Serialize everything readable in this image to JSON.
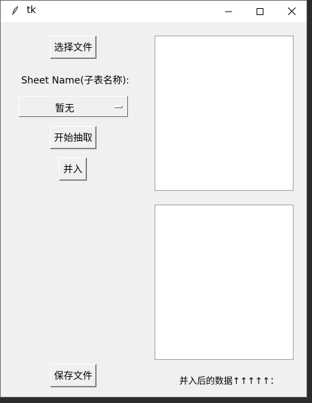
{
  "window": {
    "title": "tk",
    "icon": "feather-icon",
    "controls": {
      "minimize": "minimize-icon",
      "maximize": "maximize-icon",
      "close": "close-icon"
    }
  },
  "left_panel": {
    "choose_file_label": "选择文件",
    "sheet_name_label": "Sheet Name(子表名称):",
    "sheet_select_value": "暂无",
    "start_extract_label": "开始抽取",
    "merge_label": "并入",
    "save_file_label": "保存文件"
  },
  "right_panel": {
    "top_text": "",
    "bottom_text": "",
    "merged_data_label": "并入后的数据↑↑↑↑↑："
  }
}
